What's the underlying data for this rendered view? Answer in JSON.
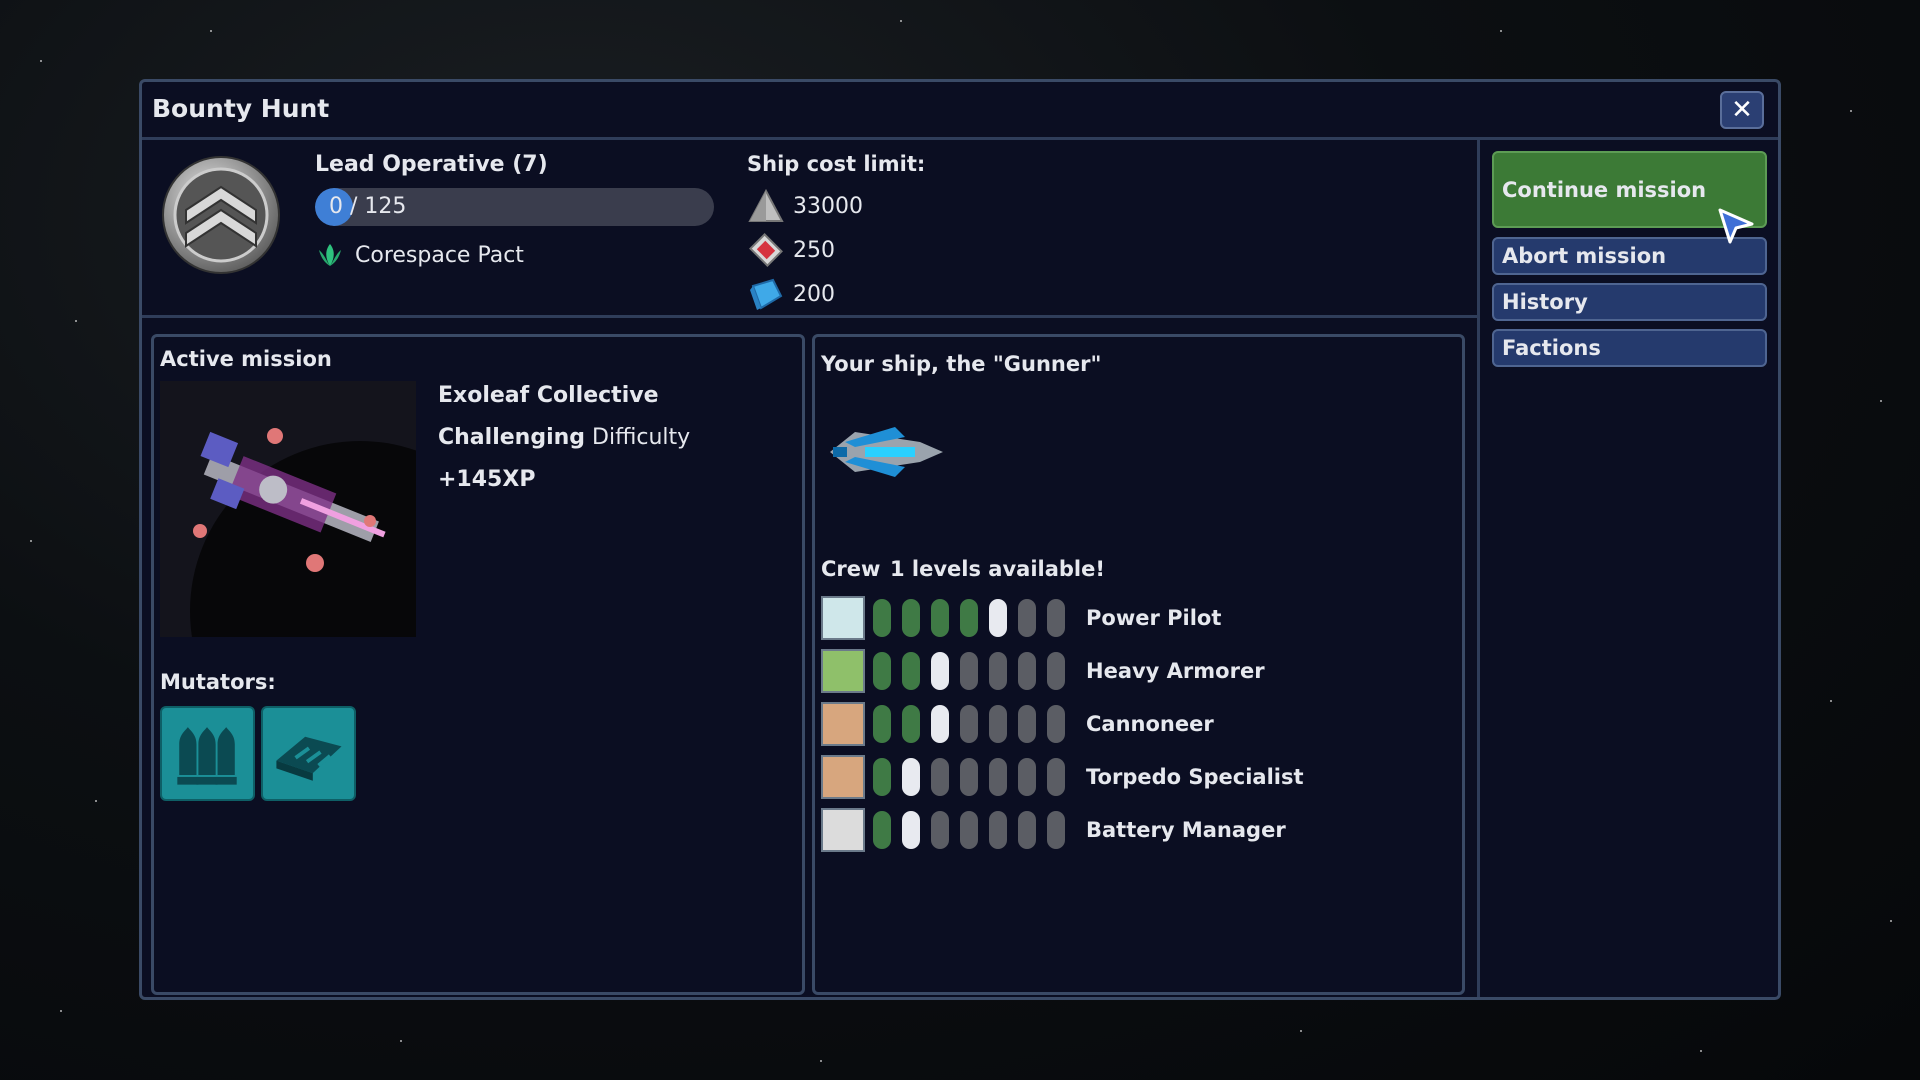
{
  "window": {
    "title": "Bounty Hunt",
    "close_label": "✕"
  },
  "rank": {
    "title": "Lead Operative (7)",
    "xp_text": "0 / 125",
    "xp_progress": 0.0
  },
  "faction": {
    "name": "Corespace Pact"
  },
  "ship_cost": {
    "label": "Ship cost limit:",
    "items": [
      {
        "icon": "triangle-resource-icon",
        "value": "33000"
      },
      {
        "icon": "red-crystal-resource-icon",
        "value": "250"
      },
      {
        "icon": "blue-cube-resource-icon",
        "value": "200"
      }
    ]
  },
  "mission": {
    "panel_title": "Active mission",
    "name": "Exoleaf Collective",
    "difficulty_word": "Challenging",
    "difficulty_suffix": " Difficulty",
    "xp": "+145XP",
    "mutators_label": "Mutators:",
    "mutators": [
      "ammo-mutator-icon",
      "armor-plate-mutator-icon"
    ]
  },
  "ship": {
    "title": "Your ship, the \"Gunner\"",
    "crew_label": "Crew",
    "crew_levels_text": "1 levels available!",
    "crew": [
      {
        "name": "Power Pilot",
        "icon": "pilot-icon",
        "filled": 4,
        "current": 5,
        "total": 7,
        "color": "#cfe7ea"
      },
      {
        "name": "Heavy Armorer",
        "icon": "armor-icon",
        "filled": 2,
        "current": 3,
        "total": 7,
        "color": "#8fc06a"
      },
      {
        "name": "Cannoneer",
        "icon": "cannon-icon",
        "filled": 2,
        "current": 3,
        "total": 7,
        "color": "#d7a67e"
      },
      {
        "name": "Torpedo Specialist",
        "icon": "torpedo-icon",
        "filled": 1,
        "current": 2,
        "total": 7,
        "color": "#d7a67e"
      },
      {
        "name": "Battery Manager",
        "icon": "battery-icon",
        "filled": 1,
        "current": 2,
        "total": 7,
        "color": "#dcdcdc"
      }
    ]
  },
  "side": {
    "continue_label": "Continue mission",
    "abort_label": "Abort mission",
    "history_label": "History",
    "factions_label": "Factions"
  },
  "colors": {
    "accent_green": "#3c7a36",
    "accent_blue": "#253a6d",
    "panel_border": "#3a4a66",
    "xp_fill": "#3f7fd6"
  }
}
